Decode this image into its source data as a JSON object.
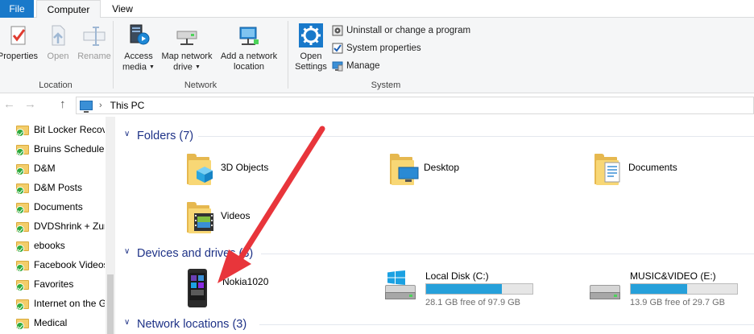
{
  "tabs": {
    "file": "File",
    "computer": "Computer",
    "view": "View"
  },
  "ribbon": {
    "location": {
      "label": "Location",
      "properties": "Properties",
      "open": "Open",
      "rename": "Rename"
    },
    "network": {
      "label": "Network",
      "access_media_1": "Access",
      "access_media_2": "media",
      "map_drive_1": "Map network",
      "map_drive_2": "drive",
      "add_location_1": "Add a network",
      "add_location_2": "location"
    },
    "system": {
      "label": "System",
      "open_settings_1": "Open",
      "open_settings_2": "Settings",
      "uninstall": "Uninstall or change a program",
      "system_properties": "System properties",
      "manage": "Manage"
    }
  },
  "address": {
    "location": "This PC"
  },
  "sidebar": {
    "items": [
      {
        "label": "Bit Locker Recovery"
      },
      {
        "label": "Bruins Schedule"
      },
      {
        "label": "D&M"
      },
      {
        "label": "D&M Posts"
      },
      {
        "label": "Documents"
      },
      {
        "label": "DVDShrink + Zune"
      },
      {
        "label": "ebooks"
      },
      {
        "label": "Facebook Videos"
      },
      {
        "label": "Favorites"
      },
      {
        "label": "Internet on the Go"
      },
      {
        "label": "Medical"
      }
    ]
  },
  "sections": {
    "folders": "Folders (7)",
    "devices": "Devices and drives (3)",
    "network": "Network locations (3)"
  },
  "folders": [
    {
      "name": "3D Objects"
    },
    {
      "name": "Desktop"
    },
    {
      "name": "Documents"
    },
    {
      "name": "Videos"
    }
  ],
  "devices": {
    "phone": {
      "name": "Nokia1020"
    },
    "local": {
      "name": "Local Disk (C:)",
      "free": "28.1 GB free of 97.9 GB",
      "used_fraction": 0.713
    },
    "music": {
      "name": "MUSIC&VIDEO (E:)",
      "free": "13.9 GB free of 29.7 GB",
      "used_fraction": 0.532
    }
  },
  "colors": {
    "accent": "#1979ca",
    "section_title": "#1e3287",
    "drive_fill": "#26a0da",
    "annotation_arrow": "#e8353b"
  }
}
